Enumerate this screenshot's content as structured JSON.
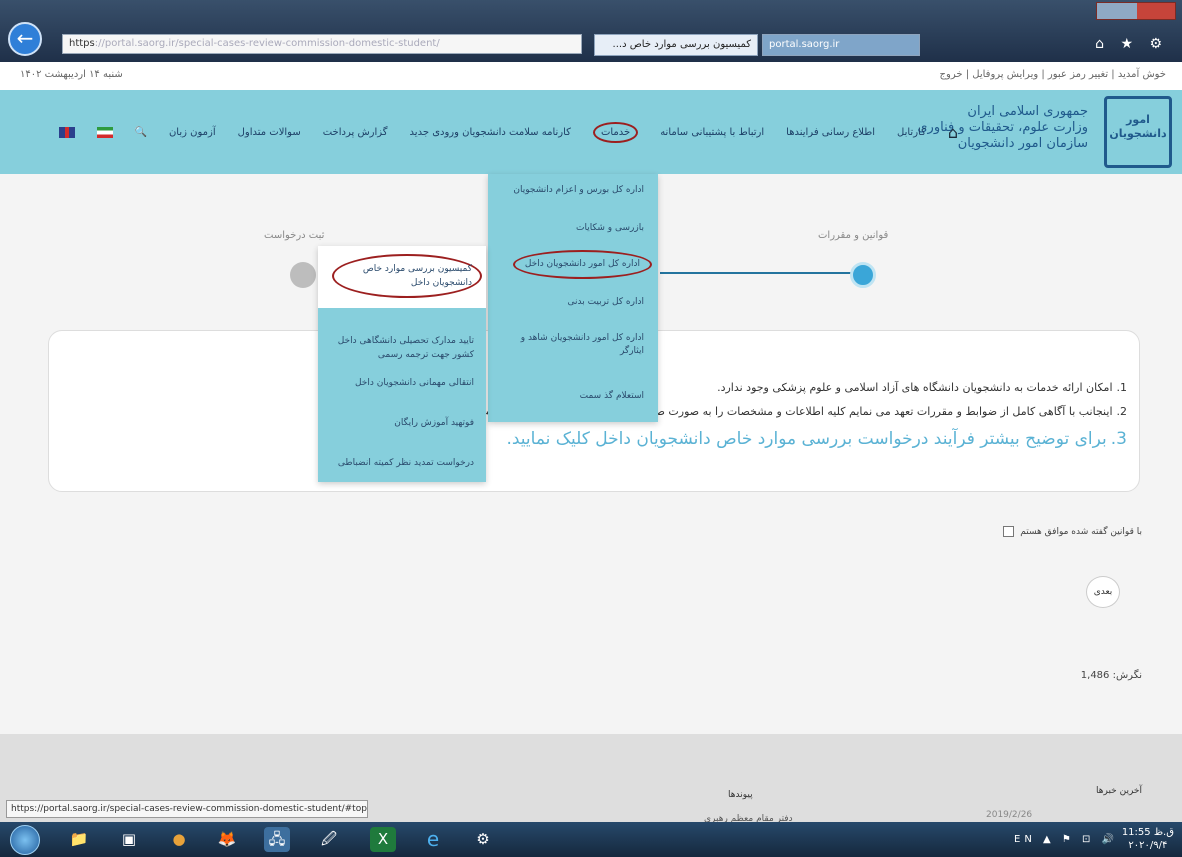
{
  "browser": {
    "address_prefix": "https",
    "address_rest": "://portal.saorg.ir/special-cases-review-commission-domestic-student/",
    "tab_active": "کمیسیون بررسی موارد خاص د...",
    "tab_other": "portal.saorg.ir",
    "chrome_icons": "⌂ ★ ⚙"
  },
  "topbar": {
    "user": "خوش آمدید  |  تغییر رمز عبور  |  ویرایش پروفایل  |  خروج",
    "date": "شنبه ۱۴ اردیبهشت ۱۴۰۲"
  },
  "header": {
    "logo": "امور دانشجویان",
    "org_line1": "جمهوری اسلامی ایران",
    "org_line2": "وزارت علوم، تحقیقات و فناوری",
    "org_line3": "سازمان امور دانشجویان"
  },
  "nav": {
    "home_icon": "⌂",
    "items": [
      "کارتابل",
      "اطلاع رسانی فرایندها",
      "ارتباط با پشتیبانی سامانه",
      "خدمات",
      "کارنامه سلامت دانشجویان ورودی جدید",
      "گزارش پرداخت",
      "سوالات متداول",
      "آزمون زبان"
    ],
    "search_icon": "🔍"
  },
  "steps": {
    "step1": "قوانین و مقررات",
    "step2": "ثبت درخواست"
  },
  "content": {
    "line1_num": "1.",
    "line1": "امکان ارائه خدمات به دانشجویان دانشگاه های آزاد اسلامی و علوم پزشکی وجود ندارد.",
    "line2_num": "2.",
    "line2": "اینجانب با آگاهی کامل از ضوابط و مقررات تعهد می نمایم کلیه اطلاعات و مشخصات را به صورت صحیح وارد نمایم و مسئولیت کلیه عواقب حقوقی آن را می پذیرم.",
    "line3_num": "3.",
    "line3": "برای توضیح بیشتر فرآیند درخواست بررسی موارد خاص دانشجویان داخل کلیک نمایید."
  },
  "menu_main": {
    "items": [
      "اداره کل بورس و اعزام دانشجویان",
      "بازرسی و شکایات",
      "اداره کل امور دانشجویان داخل",
      "اداره کل تربیت بدنی",
      "اداره کل امور دانشجویان شاهد و ایثارگر",
      "استعلام گذ سمت"
    ]
  },
  "menu_sub": {
    "items": [
      "کمیسیون بررسی موارد خاص دانشجویان داخل",
      "تایید مدارک تحصیلی دانشگاهی داخل کشور جهت ترجمه رسمی",
      "انتقالی مهمانی دانشجویان داخل",
      "فوتهید آموزش رایگان",
      "درخواست تمدید نظر کمیته انضباطی"
    ]
  },
  "form": {
    "agree_label": "با قوانین گفته شده موافق هستم",
    "next_label": "بعدی",
    "visits": "نگرش: 1,486"
  },
  "footer": {
    "links_title": "پیوندها",
    "links_item": "دفتر مقام معظم رهبری",
    "news_title": "آخرین خبرها",
    "news_item": "2019/2/26"
  },
  "statusbar": {
    "url": "https://portal.saorg.ir/special-cases-review-commission-domestic-student/#top"
  },
  "taskbar": {
    "icons": [
      "📁",
      "▣",
      "●",
      "🦊",
      "🖧",
      "🖉",
      "X",
      "e",
      "⚙"
    ],
    "tray": "EN ▲ ⚑ ⊡ 🔊",
    "time": "11:55 ق.ظ",
    "date": "۲۰۲۰/۹/۴"
  }
}
